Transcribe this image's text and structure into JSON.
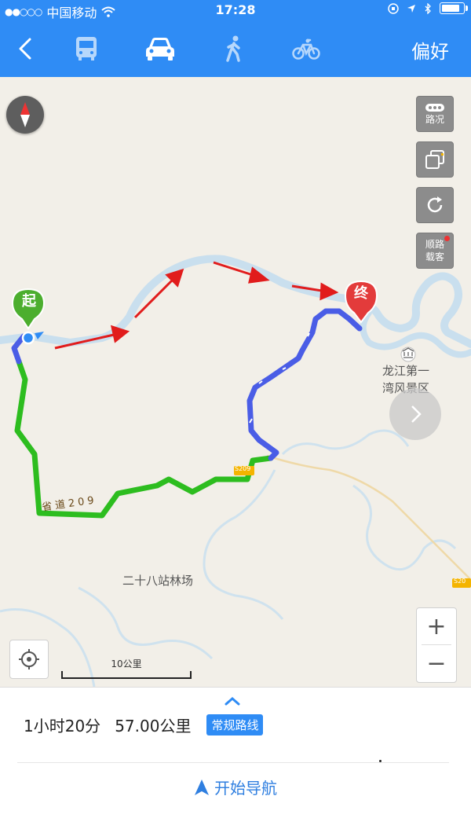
{
  "status_bar": {
    "signal": "●●○○○",
    "carrier": "中国移动",
    "time": "17:28",
    "battery_level": 0.85
  },
  "topbar": {
    "back_icon": "chevron-left-icon",
    "modes": [
      {
        "icon": "bus-icon",
        "active": false
      },
      {
        "icon": "car-icon",
        "active": true
      },
      {
        "icon": "walk-icon",
        "active": false
      },
      {
        "icon": "bike-icon",
        "active": false
      }
    ],
    "preference_label": "偏好"
  },
  "map": {
    "controls": {
      "traffic_label": "路况",
      "layers_icon": "layers-icon",
      "refresh_icon": "refresh-icon",
      "carpool_label_1": "顺路",
      "carpool_label_2": "载客"
    },
    "start_marker": "起",
    "end_marker": "终",
    "poi_line_1": "龙江第一",
    "poi_line_2": "湾风景区",
    "forest_farm_label": "二十八站林场",
    "road_label": "省道209",
    "road_badge": "S209",
    "road_badge_right": "S20",
    "scale_label": "10公里",
    "zoom_in": "+",
    "zoom_out": "−",
    "colors": {
      "route_green": "#2dbd1f",
      "route_blue": "#4a5de6",
      "river": "#cfe4f0",
      "annotation_red": "#e11c1c"
    }
  },
  "route_panel": {
    "duration": "1小时20分",
    "distance": "57.00公里",
    "route_tag": "常规路线",
    "start_navigation": "开始导航"
  }
}
